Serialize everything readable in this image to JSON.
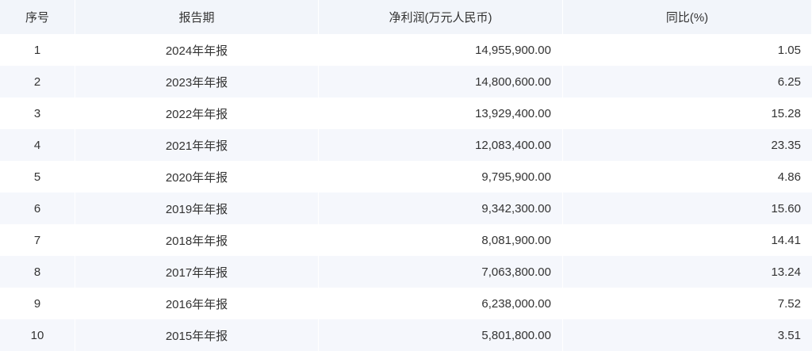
{
  "table": {
    "headers": {
      "index": "序号",
      "period": "报告期",
      "net_profit": "净利润(万元人民币)",
      "yoy": "同比(%)"
    },
    "rows": [
      {
        "index": "1",
        "period": "2024年年报",
        "net_profit": "14,955,900.00",
        "yoy": "1.05"
      },
      {
        "index": "2",
        "period": "2023年年报",
        "net_profit": "14,800,600.00",
        "yoy": "6.25"
      },
      {
        "index": "3",
        "period": "2022年年报",
        "net_profit": "13,929,400.00",
        "yoy": "15.28"
      },
      {
        "index": "4",
        "period": "2021年年报",
        "net_profit": "12,083,400.00",
        "yoy": "23.35"
      },
      {
        "index": "5",
        "period": "2020年年报",
        "net_profit": "9,795,900.00",
        "yoy": "4.86"
      },
      {
        "index": "6",
        "period": "2019年年报",
        "net_profit": "9,342,300.00",
        "yoy": "15.60"
      },
      {
        "index": "7",
        "period": "2018年年报",
        "net_profit": "8,081,900.00",
        "yoy": "14.41"
      },
      {
        "index": "8",
        "period": "2017年年报",
        "net_profit": "7,063,800.00",
        "yoy": "13.24"
      },
      {
        "index": "9",
        "period": "2016年年报",
        "net_profit": "6,238,000.00",
        "yoy": "7.52"
      },
      {
        "index": "10",
        "period": "2015年年报",
        "net_profit": "5,801,800.00",
        "yoy": "3.51"
      }
    ]
  }
}
